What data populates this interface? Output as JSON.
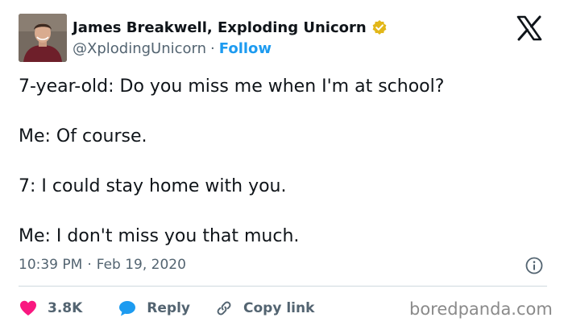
{
  "author": {
    "display_name": "James Breakwell, Exploding Unicorn",
    "handle": "@XplodingUnicorn",
    "separator": "·",
    "follow_label": "Follow"
  },
  "tweet": {
    "lines": [
      "7-year-old: Do you miss me when I'm at school?",
      "Me: Of course.",
      "7: I could stay home with you.",
      "Me: I don't miss you that much."
    ],
    "time": "10:39 PM",
    "separator": "·",
    "date": "Feb 19, 2020"
  },
  "actions": {
    "likes_count": "3.8K",
    "reply_label": "Reply",
    "copy_link_label": "Copy link"
  },
  "icons": {
    "verified": "verified-badge-icon",
    "logo": "x-logo-icon",
    "info": "info-icon",
    "like": "heart-icon",
    "reply": "speech-bubble-icon",
    "copy_link": "link-icon"
  },
  "colors": {
    "text": "#0f1419",
    "secondary": "#536471",
    "link": "#1d9bf0",
    "heart": "#f91880",
    "verified_gold": "#e2b719",
    "divider": "#cfd9de",
    "watermark": "#8a8a8a"
  },
  "watermark": "boredpanda.com"
}
